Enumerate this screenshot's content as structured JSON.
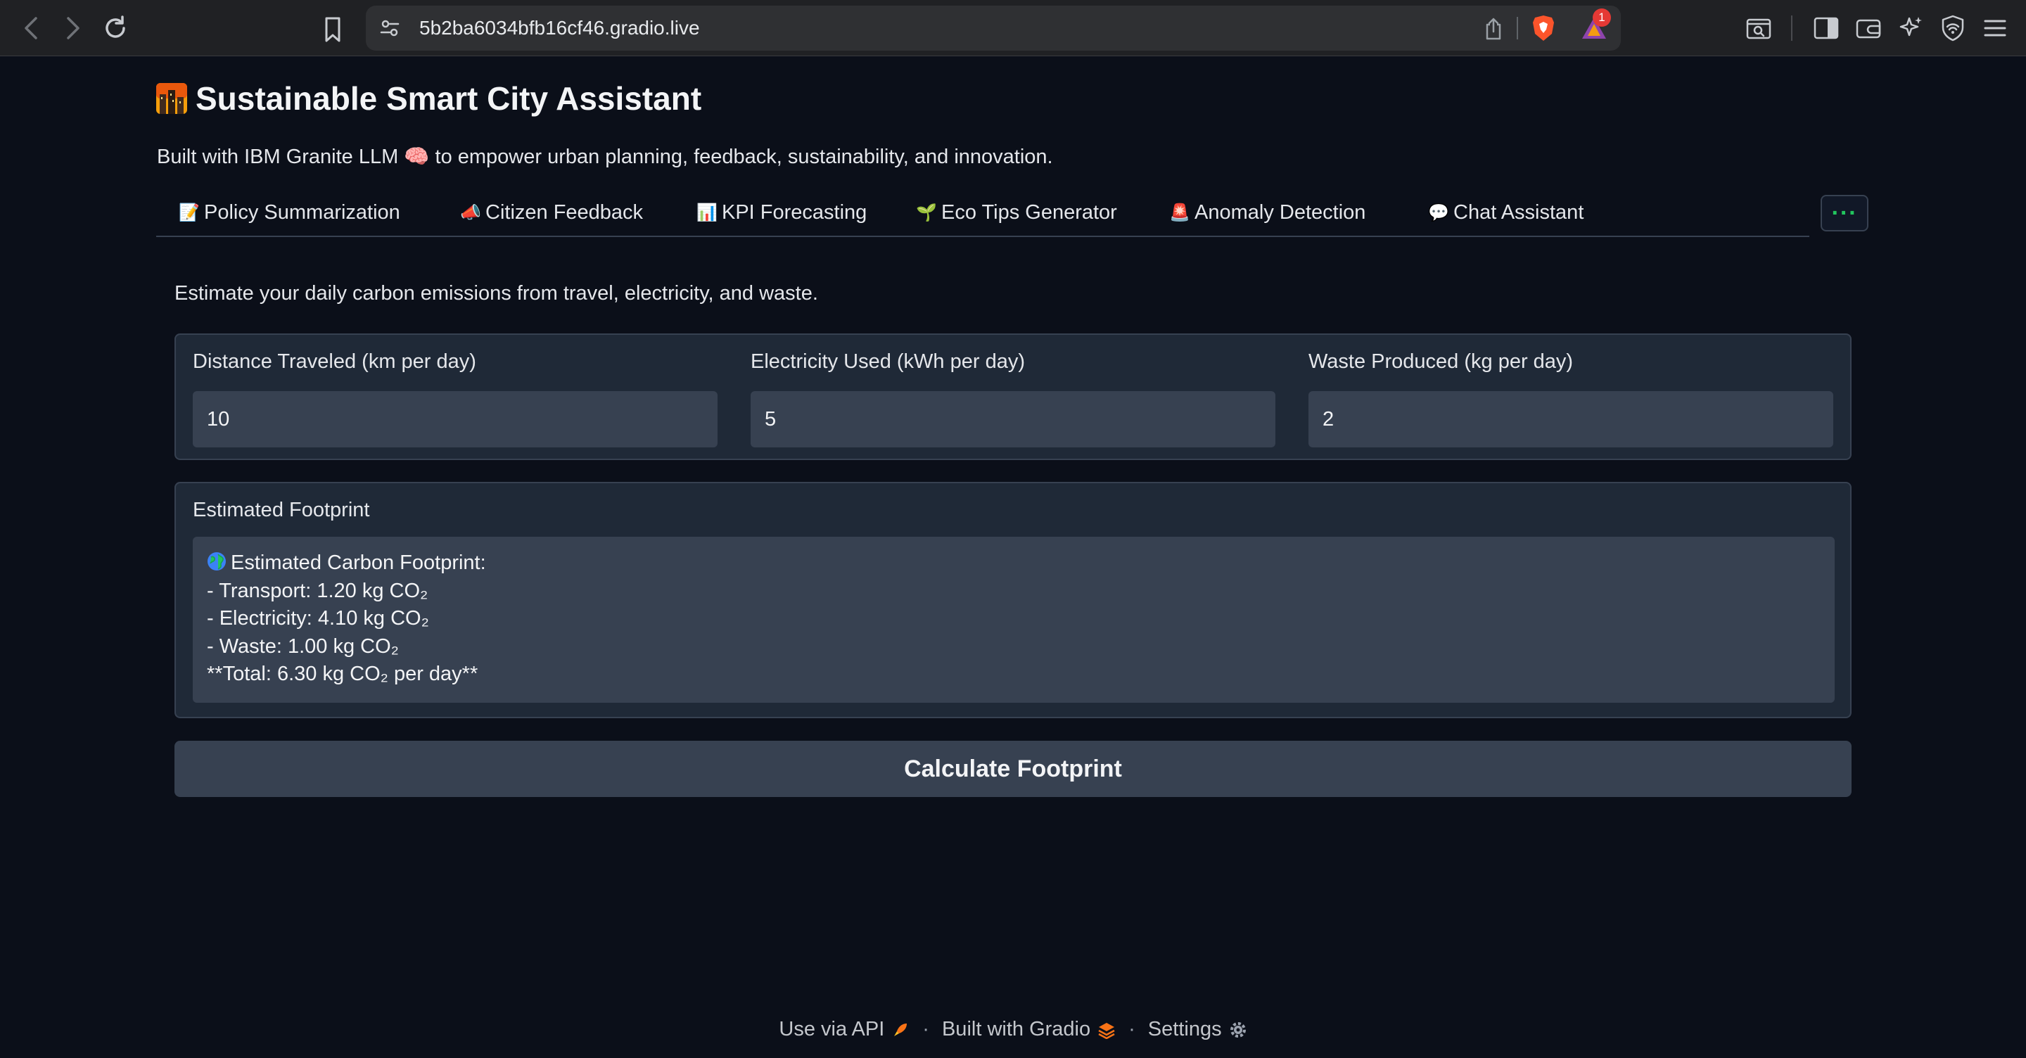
{
  "browser": {
    "url": "5b2ba6034bfb16cf46.gradio.live",
    "rewards_badge": "1"
  },
  "app": {
    "title": "Sustainable Smart City Assistant",
    "subtitle": "Built with IBM Granite LLM 🧠 to empower urban planning, feedback, sustainability, and innovation."
  },
  "tabs": [
    {
      "emoji": "📝",
      "label": "Policy Summarization"
    },
    {
      "emoji": "📣",
      "label": "Citizen Feedback"
    },
    {
      "emoji": "📊",
      "label": "KPI Forecasting"
    },
    {
      "emoji": "🌱",
      "label": "Eco Tips Generator"
    },
    {
      "emoji": "🚨",
      "label": "Anomaly Detection"
    },
    {
      "emoji": "💬",
      "label": "Chat Assistant"
    }
  ],
  "more_button": "···",
  "carbon": {
    "description": "Estimate your daily carbon emissions from travel, electricity, and waste.",
    "fields": [
      {
        "label": "Distance Traveled (km per day)",
        "value": "10"
      },
      {
        "label": "Electricity Used (kWh per day)",
        "value": "5"
      },
      {
        "label": "Waste Produced (kg per day)",
        "value": "2"
      }
    ],
    "output_label": "Estimated Footprint",
    "output_lines": [
      "Estimated Carbon Footprint:",
      "- Transport: 1.20 kg CO₂",
      "- Electricity: 4.10 kg CO₂",
      "- Waste: 1.00 kg CO₂",
      "**Total: 6.30 kg CO₂ per day**"
    ],
    "button_label": "Calculate Footprint"
  },
  "footer": {
    "api": "Use via API",
    "built": "Built with Gradio",
    "settings": "Settings"
  },
  "colors": {
    "page_bg": "#0b0f19",
    "panel_bg": "#1f2937",
    "input_bg": "#374151",
    "accent_green": "#22c55e"
  }
}
